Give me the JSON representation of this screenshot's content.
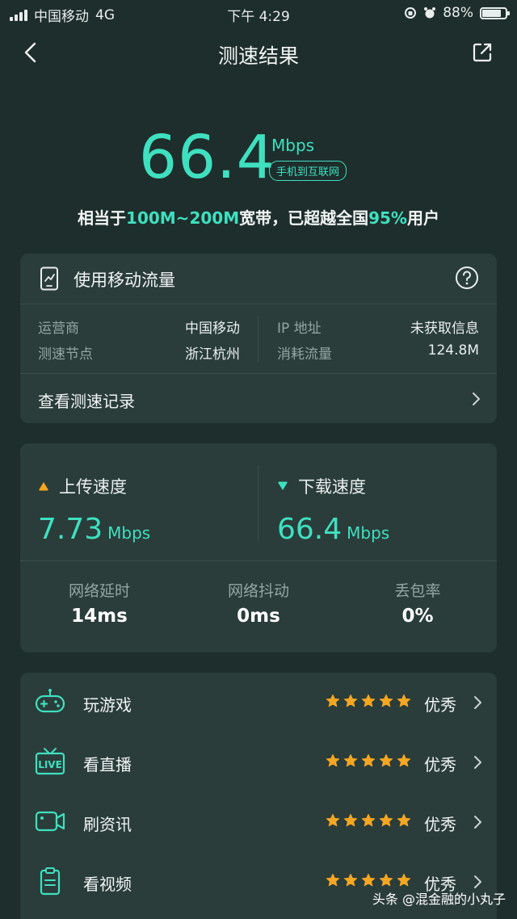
{
  "status_bar": {
    "carrier": "中国移动",
    "network": "4G",
    "time": "下午 4:29",
    "battery": "88%",
    "battery_level": 0.88
  },
  "nav": {
    "title": "测速结果"
  },
  "hero": {
    "speed": "66.4",
    "unit": "Mbps",
    "tag": "手机到互联网"
  },
  "summary": {
    "prefix": "相当于",
    "bandwidth": "100M~200M",
    "mid": "宽带，已超越全国",
    "percent": "95%",
    "suffix": "用户"
  },
  "network_card": {
    "title": "使用移动流量",
    "operator_label": "运营商",
    "operator_value": "中国移动",
    "node_label": "测速节点",
    "node_value": "浙江杭州",
    "ip_label": "IP 地址",
    "ip_value": "未获取信息",
    "traffic_label": "消耗流量",
    "traffic_value": "124.8M",
    "history_label": "查看测速记录"
  },
  "speed_card": {
    "upload_label": "上传速度",
    "upload_value": "7.73",
    "upload_unit": "Mbps",
    "download_label": "下载速度",
    "download_value": "66.4",
    "download_unit": "Mbps",
    "latency_label": "网络延时",
    "latency_value": "14ms",
    "jitter_label": "网络抖动",
    "jitter_value": "0ms",
    "loss_label": "丢包率",
    "loss_value": "0%"
  },
  "scenarios": [
    {
      "label": "玩游戏",
      "rating": "优秀",
      "stars": 5,
      "icon": "gamepad-icon"
    },
    {
      "label": "看直播",
      "rating": "优秀",
      "stars": 5,
      "icon": "live-tv-icon"
    },
    {
      "label": "刷资讯",
      "rating": "优秀",
      "stars": 5,
      "icon": "video-camera-icon"
    },
    {
      "label": "看视频",
      "rating": "优秀",
      "stars": 5,
      "icon": "clipboard-icon"
    }
  ],
  "watermark": "头条 @混金融的小丸子",
  "colors": {
    "accent": "#3fe0bf",
    "background": "#1e2e2c",
    "card": "#2a3d3b",
    "upload": "#f5a623",
    "star": "#f5a623"
  }
}
